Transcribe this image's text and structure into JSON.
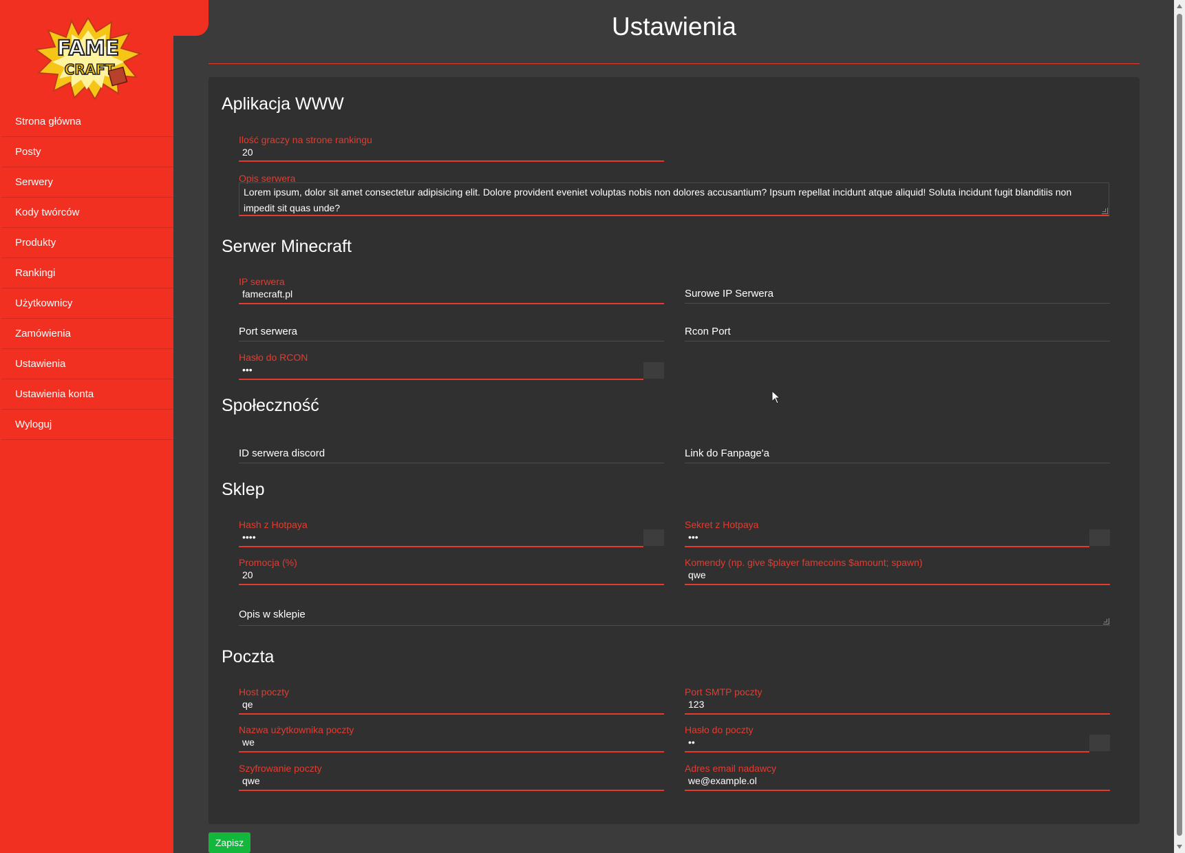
{
  "colors": {
    "accent": "#f13022",
    "save": "#12b73c",
    "background": "#3b3b3b",
    "card": "#303030"
  },
  "sidebar": {
    "logo_text_top": "FAME",
    "logo_text_bottom": "CRAFT",
    "items": [
      {
        "label": "Strona główna"
      },
      {
        "label": "Posty"
      },
      {
        "label": "Serwery"
      },
      {
        "label": "Kody twórców"
      },
      {
        "label": "Produkty"
      },
      {
        "label": "Rankingi"
      },
      {
        "label": "Użytkownicy"
      },
      {
        "label": "Zamówienia"
      },
      {
        "label": "Ustawienia"
      },
      {
        "label": "Ustawienia konta"
      },
      {
        "label": "Wyloguj"
      }
    ]
  },
  "header": {
    "title": "Ustawienia"
  },
  "sections": {
    "www": {
      "title": "Aplikacja WWW",
      "players_label": "Ilość graczy na strone rankingu",
      "players_value": "20",
      "desc_label": "Opis serwera",
      "desc_value": "Lorem ipsum, dolor sit amet consectetur adipisicing elit. Dolore provident eveniet voluptas nobis non dolores accusantium? Ipsum repellat incidunt atque aliquid! Soluta incidunt fugit blanditiis non impedit sit quas unde?"
    },
    "minecraft": {
      "title": "Serwer Minecraft",
      "ip_label": "IP serwera",
      "ip_value": "famecraft.pl",
      "raw_ip_placeholder": "Surowe IP Serwera",
      "port_placeholder": "Port serwera",
      "rcon_port_placeholder": "Rcon Port",
      "rcon_pass_label": "Hasło do RCON",
      "rcon_pass_value": "•••"
    },
    "community": {
      "title": "Społeczność",
      "discord_placeholder": "ID serwera discord",
      "fanpage_placeholder": "Link do Fanpage'a"
    },
    "shop": {
      "title": "Sklep",
      "hash_label": "Hash z Hotpaya",
      "hash_value": "••••",
      "secret_label": "Sekret z Hotpaya",
      "secret_value": "•••",
      "promo_label": "Promocja (%)",
      "promo_value": "20",
      "commands_label": "Komendy (np. give $player famecoins $amount; spawn)",
      "commands_value": "qwe",
      "shop_desc_placeholder": "Opis w sklepie"
    },
    "mail": {
      "title": "Poczta",
      "host_label": "Host poczty",
      "host_value": "qe",
      "smtp_label": "Port SMTP poczty",
      "smtp_value": "123",
      "user_label": "Nazwa użytkownika poczty",
      "user_value": "we",
      "pass_label": "Hasło do poczty",
      "pass_value": "••",
      "enc_label": "Szyfrowanie poczty",
      "enc_value": "qwe",
      "sender_label": "Adres email nadawcy",
      "sender_value": "we@example.ol"
    }
  },
  "save_label": "Zapisz"
}
